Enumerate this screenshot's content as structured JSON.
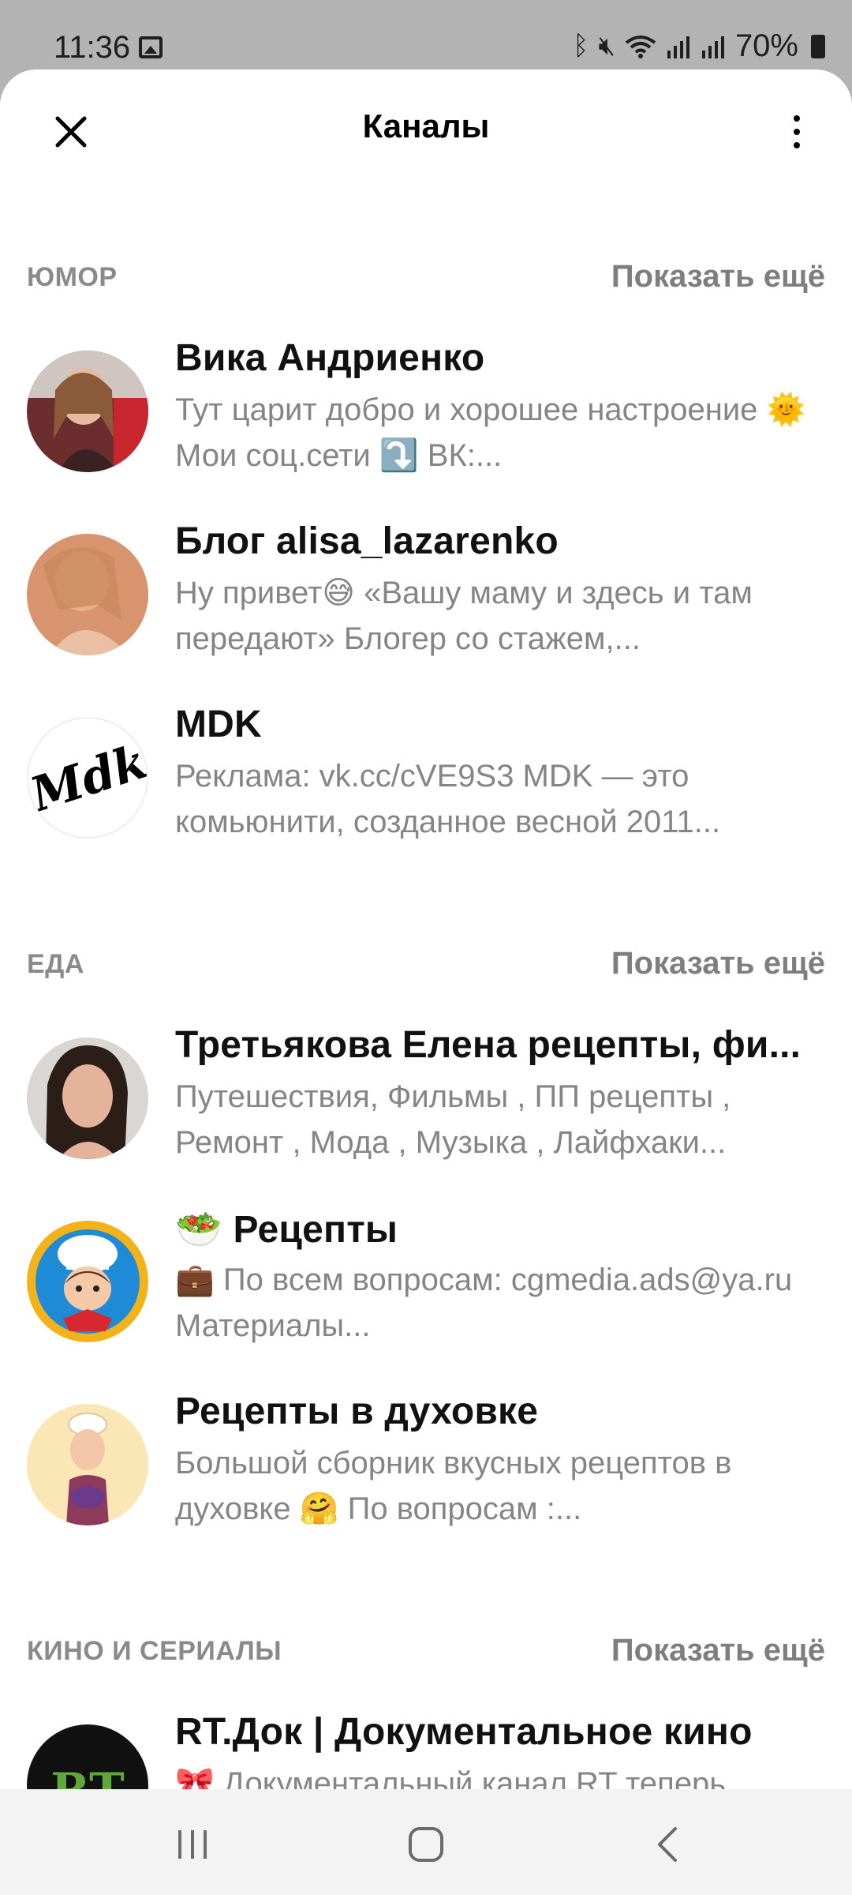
{
  "status": {
    "time": "11:36",
    "battery": "70%"
  },
  "header": {
    "title": "Каналы"
  },
  "sections": [
    {
      "title": "ЮМОР",
      "more": "Показать ещё",
      "items": [
        {
          "name": "Вика Андриенко",
          "desc": "Тут царит добро и хорошее настроение 🌞 Мои соц.сети ⤵️ ВК:..."
        },
        {
          "name": "Блог alisa_lazarenko",
          "desc": "Ну привет😅 «Вашу маму и здесь и там передают» Блогер со стажем,..."
        },
        {
          "name": "MDK",
          "desc": "Реклама: vk.cc/cVE9S3 MDK — это комьюнити, созданное весной 2011..."
        }
      ]
    },
    {
      "title": "ЕДА",
      "more": "Показать ещё",
      "items": [
        {
          "name": "Третьякова Елена рецепты, фи...",
          "desc": "Путешествия, Фильмы , ПП рецепты , Ремонт , Мода , Музыка , Лайфхаки..."
        },
        {
          "name": "🥗 Рецепты",
          "desc": "💼 По всем вопросам: cgmedia.ads@ya.ru Материалы..."
        },
        {
          "name": "Рецепты в духовке",
          "desc": "Большой сборник вкусных рецептов в духовке 🤗 По вопросам :..."
        }
      ]
    },
    {
      "title": "КИНО И СЕРИАЛЫ",
      "more": "Показать ещё",
      "items": [
        {
          "name": "RT.Док | Документальное кино",
          "desc": "🎀 Документальный канал RT теперь"
        }
      ]
    }
  ]
}
